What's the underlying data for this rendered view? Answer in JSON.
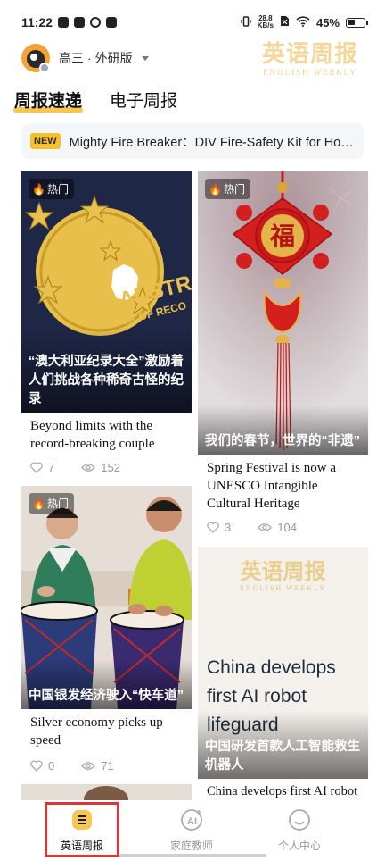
{
  "status_bar": {
    "time": "11:22",
    "net_speed_value": "28.8",
    "net_speed_unit": "KB/s",
    "battery": "45%"
  },
  "header": {
    "user_name": "高三",
    "separator": "·",
    "edition": "外研版",
    "brand_cn": "英语周报",
    "brand_en": "ENGLISH WEEKLY"
  },
  "tabs": [
    {
      "label": "周报速递",
      "active": true
    },
    {
      "label": "电子周报",
      "active": false
    }
  ],
  "ticker": {
    "badge": "NEW",
    "text": "Mighty Fire Breaker：DIV Fire-Safety Kit for Ho…"
  },
  "cards": [
    {
      "badge": "热门",
      "image_caption": "“澳大利亚纪录大全”激励着人们挑战各种稀奇古怪的纪录",
      "image_text": "THE AUSTRALIAN BOOK OF RECORDS",
      "title": "Beyond limits with the record-breaking couple",
      "likes": "7",
      "views": "152"
    },
    {
      "badge": "热门",
      "image_caption": "我们的春节，世界的“非遗”",
      "image_text": "福",
      "title": "Spring Festival is now a UNESCO Intangible Cultural Heritage",
      "likes": "3",
      "views": "104"
    },
    {
      "badge": "热门",
      "image_caption": "中国银发经济驶入“快车道”",
      "title": "Silver economy picks up speed",
      "likes": "0",
      "views": "71"
    },
    {
      "brand_cn": "英语周报",
      "brand_en": "ENGLISH WEEKLY",
      "image_headline": "China develops first AI robot lifeguard",
      "image_caption": "中国研发首款人工智能救生机器人",
      "title": "China develops first AI robot"
    }
  ],
  "bottom_nav": [
    {
      "label": "英语周报",
      "icon": "newspaper-icon",
      "active": true
    },
    {
      "label": "家庭教师",
      "icon": "ai-tutor-icon",
      "active": false
    },
    {
      "label": "个人中心",
      "icon": "profile-icon",
      "active": false
    }
  ],
  "colors": {
    "accent_yellow": "#f9c74f",
    "highlight_red": "#e23434",
    "fire_orange": "#ff7a1a"
  }
}
